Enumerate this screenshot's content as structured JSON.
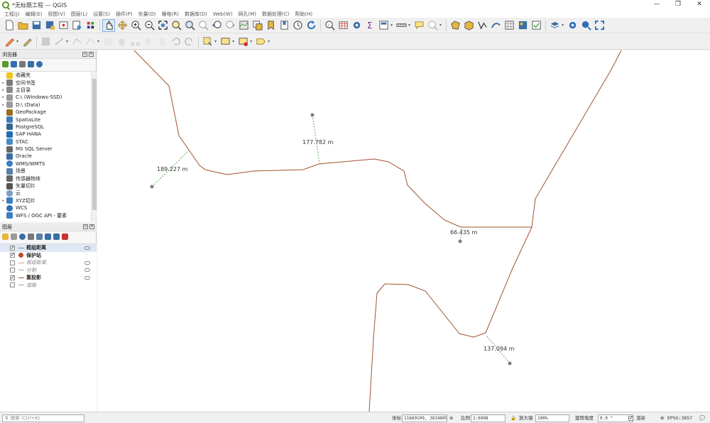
{
  "window": {
    "title": "*无标题工程 — QGIS",
    "controls": [
      "—",
      "❐",
      "✕"
    ]
  },
  "menu": [
    "工程(J)",
    "编辑(E)",
    "视图(V)",
    "图层(L)",
    "设置(S)",
    "插件(P)",
    "矢量(O)",
    "栅格(R)",
    "数据库(D)",
    "Web(W)",
    "网孔(M)",
    "数据处理(C)",
    "帮助(H)"
  ],
  "browser": {
    "title": "浏览器",
    "items": [
      {
        "label": "收藏夹",
        "icon": "star-icon",
        "color": "#f0c419",
        "arrow": ""
      },
      {
        "label": "空间书签",
        "icon": "bookmark-icon",
        "color": "#7a7a7a",
        "arrow": "▸"
      },
      {
        "label": "主目录",
        "icon": "home-icon",
        "color": "#8a8a8a",
        "arrow": "▸"
      },
      {
        "label": "C:\\ (Windows-SSD)",
        "icon": "folder-icon",
        "color": "#9a9a9a",
        "arrow": "▸"
      },
      {
        "label": "D:\\ (Data)",
        "icon": "folder-icon",
        "color": "#9a9a9a",
        "arrow": "▸"
      },
      {
        "label": "GeoPackage",
        "icon": "geopackage-icon",
        "color": "#9c6b1d",
        "arrow": ""
      },
      {
        "label": "SpatiaLite",
        "icon": "feather-icon",
        "color": "#3b7dbd",
        "arrow": ""
      },
      {
        "label": "PostgreSQL",
        "icon": "elephant-icon",
        "color": "#336791",
        "arrow": ""
      },
      {
        "label": "SAP HANA",
        "icon": "database-icon",
        "color": "#1f6fb2",
        "arrow": ""
      },
      {
        "label": "STAC",
        "icon": "stac-icon",
        "color": "#4a8bc9",
        "arrow": ""
      },
      {
        "label": "MS SQL Server",
        "icon": "sqlserver-icon",
        "color": "#666666",
        "arrow": ""
      },
      {
        "label": "Oracle",
        "icon": "oracle-icon",
        "color": "#3a6ea5",
        "arrow": ""
      },
      {
        "label": "WMS/WMTS",
        "icon": "globe-icon",
        "color": "#3a7ec2",
        "arrow": ""
      },
      {
        "label": "场景",
        "icon": "scene-icon",
        "color": "#5a7fa8",
        "arrow": ""
      },
      {
        "label": "传感器物体",
        "icon": "sensor-icon",
        "color": "#666666",
        "arrow": ""
      },
      {
        "label": "矢量切片",
        "icon": "grid-icon",
        "color": "#555555",
        "arrow": ""
      },
      {
        "label": "云",
        "icon": "cloud-icon",
        "color": "#7aa0c8",
        "arrow": ""
      },
      {
        "label": "XYZ切片",
        "icon": "tiles-icon",
        "color": "#3a7ec2",
        "arrow": "▸"
      },
      {
        "label": "WCS",
        "icon": "globe-icon",
        "color": "#2d6fb3",
        "arrow": ""
      },
      {
        "label": "WFS / OGC API - 要素",
        "icon": "wfs-icon",
        "color": "#3a7ec2",
        "arrow": ""
      }
    ]
  },
  "layers": {
    "title": "图层",
    "items": [
      {
        "name": "框组距离",
        "checked": true,
        "style": "bold",
        "symbol": "line",
        "eye": true
      },
      {
        "name": "保护站",
        "checked": true,
        "style": "bold",
        "symbol": "point",
        "eye": false
      },
      {
        "name": "框组距离",
        "checked": false,
        "style": "italic",
        "symbol": "line",
        "eye": true
      },
      {
        "name": "分割",
        "checked": false,
        "style": "italic",
        "symbol": "line",
        "eye": true
      },
      {
        "name": "重投影",
        "checked": true,
        "style": "bold",
        "symbol": "line",
        "eye": true
      },
      {
        "name": "道路",
        "checked": false,
        "style": "italic",
        "symbol": "line",
        "eye": false
      }
    ]
  },
  "map": {
    "road_color": "#a0522d",
    "connector_color": "#5aaa50",
    "point_color": "#7a7a85",
    "distances": [
      "177.782 m",
      "189.227 m",
      "66.435 m",
      "137.094 m"
    ]
  },
  "status": {
    "search_placeholder": "搜索 (Ctrl+K)",
    "coordinate_label": "坐标",
    "coordinate_value": "11669109, 3834899",
    "scale_label": "比例",
    "scale_value": "1:6908",
    "magnifier_label": "放大镜",
    "magnifier_value": "100%",
    "rotation_label": "旋转角度",
    "rotation_value": "0.0 °",
    "render_label": "渲染",
    "crs": "EPSG:3857"
  }
}
